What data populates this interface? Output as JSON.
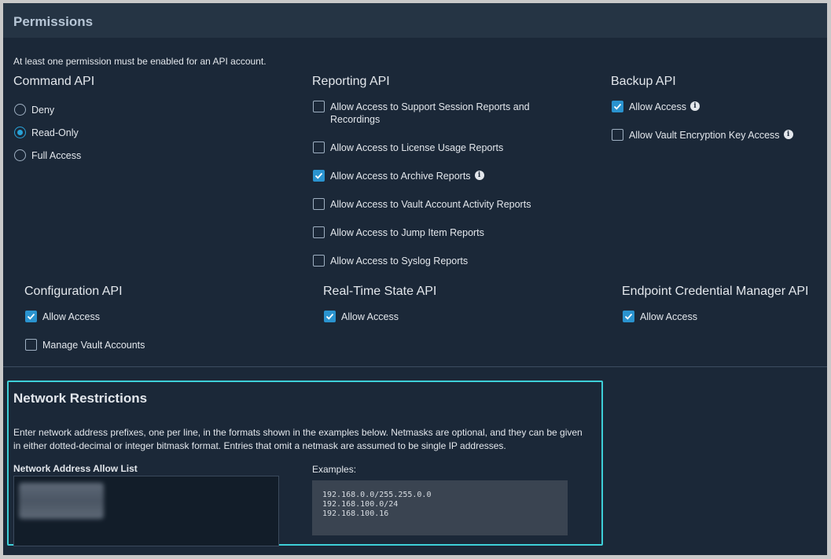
{
  "permissions": {
    "title": "Permissions",
    "note": "At least one permission must be enabled for an API account."
  },
  "command_api": {
    "title": "Command API",
    "options": [
      {
        "label": "Deny",
        "selected": false
      },
      {
        "label": "Read-Only",
        "selected": true
      },
      {
        "label": "Full Access",
        "selected": false
      }
    ]
  },
  "reporting_api": {
    "title": "Reporting API",
    "options": [
      {
        "label": "Allow Access to Support Session Reports and Recordings",
        "checked": false
      },
      {
        "label": "Allow Access to License Usage Reports",
        "checked": false
      },
      {
        "label": "Allow Access to Archive Reports",
        "checked": true,
        "info": true
      },
      {
        "label": "Allow Access to Vault Account Activity Reports",
        "checked": false
      },
      {
        "label": "Allow Access to Jump Item Reports",
        "checked": false
      },
      {
        "label": "Allow Access to Syslog Reports",
        "checked": false
      }
    ]
  },
  "backup_api": {
    "title": "Backup API",
    "options": [
      {
        "label": "Allow Access",
        "checked": true,
        "info": true
      },
      {
        "label": "Allow Vault Encryption Key Access",
        "checked": false,
        "info": true
      }
    ]
  },
  "configuration_api": {
    "title": "Configuration API",
    "options": [
      {
        "label": "Allow Access",
        "checked": true
      },
      {
        "label": "Manage Vault Accounts",
        "checked": false
      }
    ]
  },
  "realtime_api": {
    "title": "Real-Time State API",
    "options": [
      {
        "label": "Allow Access",
        "checked": true
      }
    ]
  },
  "ecm_api": {
    "title": "Endpoint Credential Manager API",
    "options": [
      {
        "label": "Allow Access",
        "checked": true
      }
    ]
  },
  "network": {
    "title": "Network Restrictions",
    "description": "Enter network address prefixes, one per line, in the formats shown in the examples below. Netmasks are optional, and they can be given in either dotted-decimal or integer bitmask format. Entries that omit a netmask are assumed to be single IP addresses.",
    "allow_list_label": "Network Address Allow List",
    "examples_label": "Examples:",
    "examples": [
      "192.168.0.0/255.255.0.0",
      "192.168.100.0/24",
      "192.168.100.16"
    ]
  },
  "colors": {
    "background": "#1b2838",
    "header": "#253444",
    "accent": "#2a93cf",
    "highlight_border": "#3ecfd8"
  },
  "icons": {
    "info": "info-circle-icon",
    "check": "checkmark-icon"
  }
}
